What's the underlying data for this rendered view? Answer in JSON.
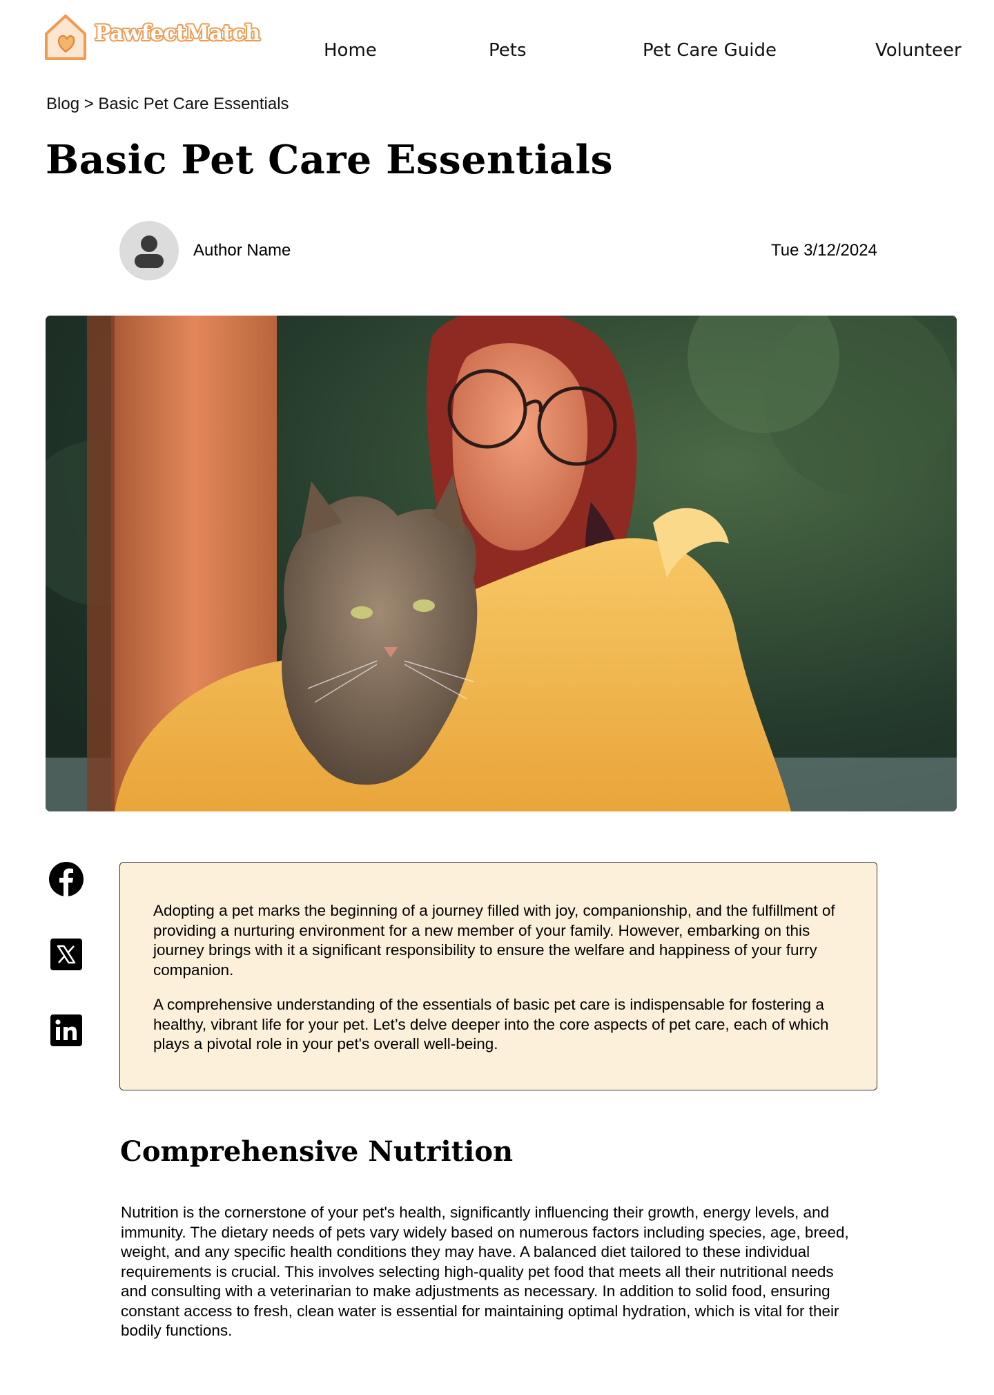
{
  "brand": {
    "name": "PawfectMatch",
    "color": "#f09a52"
  },
  "nav": {
    "items": [
      {
        "label": "Home"
      },
      {
        "label": "Pets"
      },
      {
        "label": "Pet Care Guide"
      },
      {
        "label": "Volunteer"
      }
    ]
  },
  "breadcrumb": {
    "root": "Blog",
    "separator": " > ",
    "current": "Basic Pet Care Essentials"
  },
  "article": {
    "title": "Basic Pet Care Essentials",
    "author": "Author Name",
    "date": "Tue 3/12/2024",
    "hero_icon": "woman-holding-kitten-photo",
    "intro": [
      "Adopting a pet marks the beginning of a journey filled with joy, companionship, and the fulfillment of providing a nurturing environment for a new member of your family. However, embarking on this journey brings with it a significant responsibility to ensure the welfare and happiness of your furry companion.",
      "A comprehensive understanding of the essentials of basic pet care is indispensable for fostering a healthy, vibrant life for your pet. Let’s delve deeper into the core aspects of pet care, each of which plays a pivotal role in your pet's overall well-being."
    ],
    "sections": [
      {
        "title": "Comprehensive Nutrition",
        "body": "Nutrition is the cornerstone of your pet's health, significantly influencing their growth, energy levels, and immunity. The dietary needs of pets vary widely based on numerous factors including species, age, breed, weight, and any specific health conditions they may have. A balanced diet tailored to these individual requirements is crucial. This involves selecting high-quality pet food that meets all their nutritional needs and consulting with a veterinarian to make adjustments as necessary. In addition to solid food, ensuring constant access to fresh, clean water is essential for maintaining optimal hydration, which is vital for their bodily functions."
      }
    ]
  },
  "social": [
    {
      "icon": "facebook-icon"
    },
    {
      "icon": "x-twitter-icon"
    },
    {
      "icon": "linkedin-icon"
    }
  ],
  "colors": {
    "intro_bg": "#fcf0da",
    "accent": "#f09a52",
    "avatar_bg": "#dcdcdc"
  }
}
